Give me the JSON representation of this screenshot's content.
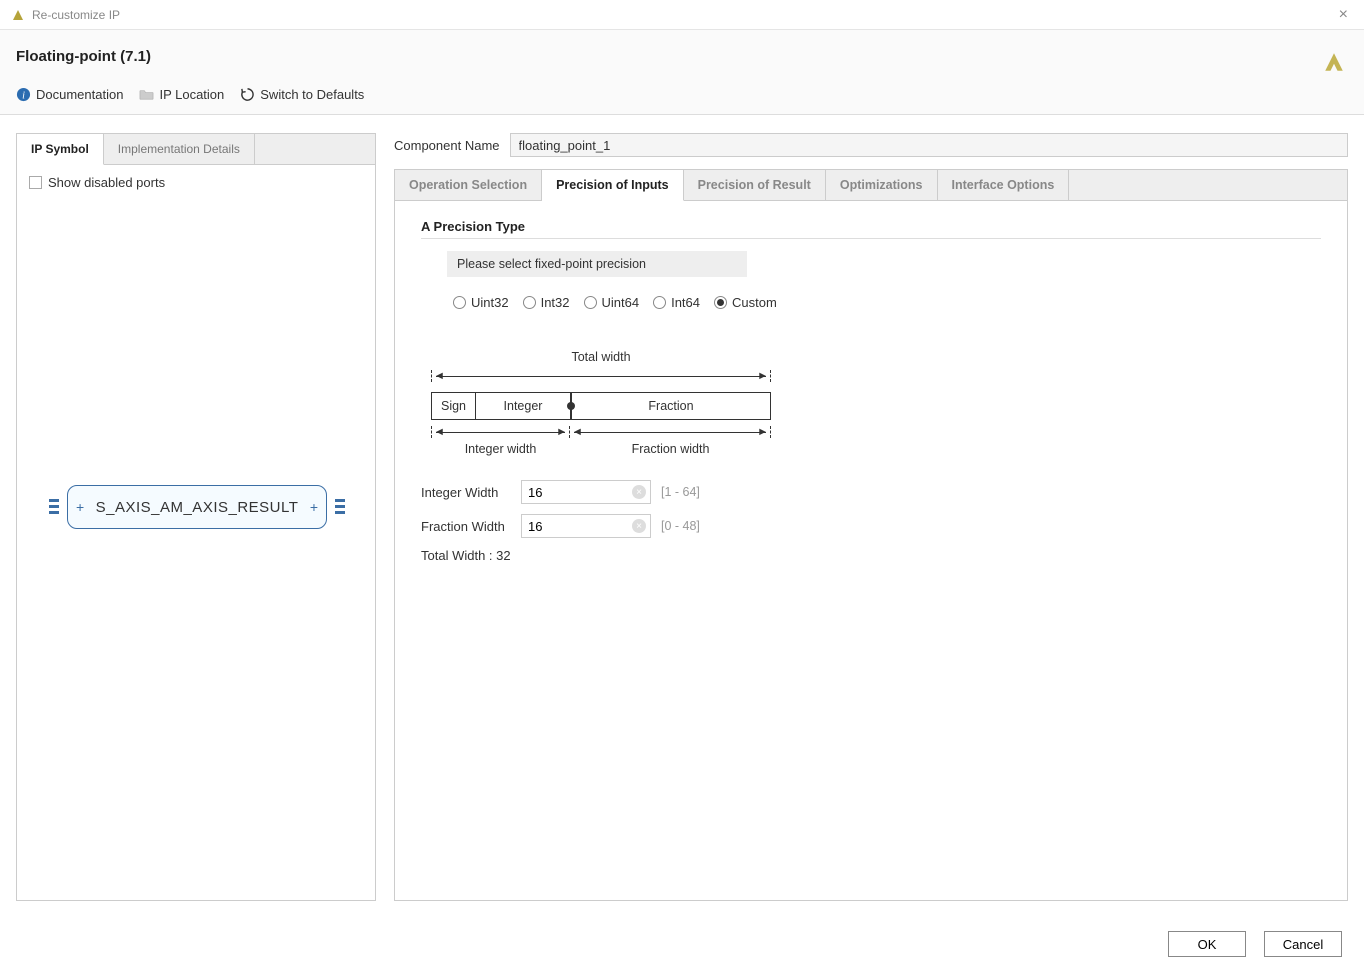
{
  "titlebar": {
    "title": "Re-customize IP"
  },
  "header": {
    "title": "Floating-point (7.1)",
    "links": {
      "documentation": "Documentation",
      "ip_location": "IP Location",
      "switch_defaults": "Switch to Defaults"
    }
  },
  "left": {
    "tabs": {
      "symbol": "IP Symbol",
      "impl": "Implementation Details"
    },
    "show_disabled": "Show disabled ports",
    "block_text": "S_AXIS_AM_AXIS_RESULT"
  },
  "component_name": {
    "label": "Component Name",
    "value": "floating_point_1"
  },
  "right_tabs": {
    "op_sel": "Operation Selection",
    "prec_in": "Precision of Inputs",
    "prec_res": "Precision of Result",
    "opt": "Optimizations",
    "iface": "Interface Options"
  },
  "precision": {
    "section_title": "A Precision Type",
    "hint": "Please select fixed-point precision",
    "radios": {
      "uint32": "Uint32",
      "int32": "Int32",
      "uint64": "Uint64",
      "int64": "Int64",
      "custom": "Custom"
    },
    "diagram": {
      "total_width": "Total width",
      "sign": "Sign",
      "integer": "Integer",
      "fraction": "Fraction",
      "integer_width": "Integer width",
      "fraction_width": "Fraction width"
    },
    "integer_width": {
      "label": "Integer Width",
      "value": "16",
      "range": "[1 - 64]"
    },
    "fraction_width": {
      "label": "Fraction Width",
      "value": "16",
      "range": "[0 - 48]"
    },
    "total": "Total Width : 32"
  },
  "footer": {
    "ok": "OK",
    "cancel": "Cancel"
  }
}
